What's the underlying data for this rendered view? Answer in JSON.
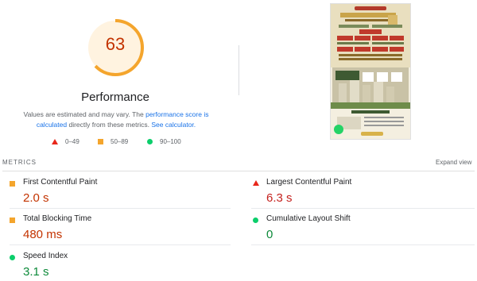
{
  "gauge": {
    "score": "63",
    "score_fraction": 0.63,
    "arc_color": "#f4a52d",
    "fill_color": "#fff3e0",
    "text_color": "#c33300"
  },
  "performance": {
    "title": "Performance",
    "desc_part1": "Values are estimated and may vary. The ",
    "desc_link1": "performance score is calculated",
    "desc_part2": " directly from these metrics. ",
    "desc_link2": "See calculator."
  },
  "legend": [
    {
      "range": "0–49",
      "icon": "red-triangle-icon"
    },
    {
      "range": "50–89",
      "icon": "orange-square-icon"
    },
    {
      "range": "90–100",
      "icon": "green-circle-icon"
    }
  ],
  "metrics": {
    "header": "METRICS",
    "expand": "Expand view",
    "items": [
      {
        "label": "First Contentful Paint",
        "value": "2.0 s",
        "status": "average",
        "color": "#c33300"
      },
      {
        "label": "Largest Contentful Paint",
        "value": "6.3 s",
        "status": "fail",
        "color": "#c5221f"
      },
      {
        "label": "Total Blocking Time",
        "value": "480 ms",
        "status": "average",
        "color": "#c33300"
      },
      {
        "label": "Cumulative Layout Shift",
        "value": "0",
        "status": "pass",
        "color": "#0d8a3a"
      },
      {
        "label": "Speed Index",
        "value": "3.1 s",
        "status": "pass",
        "color": "#0d8a3a"
      }
    ]
  },
  "colors": {
    "fail": "#e8271b",
    "average": "#f4a52d",
    "pass": "#0cce6b",
    "link": "#1a73e8"
  }
}
